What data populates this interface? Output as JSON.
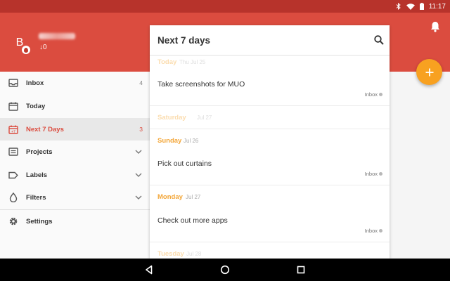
{
  "status_bar": {
    "time": "11:17"
  },
  "header": {
    "avatar_letter": "B",
    "karma": "↓0"
  },
  "sidebar": {
    "items": [
      {
        "label": "Inbox",
        "count": "4",
        "icon": "inbox-icon"
      },
      {
        "label": "Today",
        "count": "",
        "icon": "calendar-icon"
      },
      {
        "label": "Next 7 Days",
        "count": "3",
        "icon": "calendar-plus-icon",
        "active": true
      },
      {
        "label": "Projects",
        "icon": "list-icon"
      },
      {
        "label": "Labels",
        "icon": "tag-icon"
      },
      {
        "label": "Filters",
        "icon": "drop-icon"
      },
      {
        "label": "Settings",
        "icon": "gear-icon"
      }
    ]
  },
  "panel": {
    "title": "Next 7 days",
    "days": [
      {
        "name": "Today",
        "date": "Thu Jul 25"
      },
      {
        "name": "Saturday",
        "date": "Jul 27"
      },
      {
        "name": "Sunday",
        "date": "Jul 26"
      },
      {
        "name": "Monday",
        "date": "Jul 27"
      },
      {
        "name": "Tuesday",
        "date": "Jul 28"
      }
    ],
    "tasks": [
      {
        "title": "Take screenshots for MUO",
        "project": "Inbox"
      },
      {
        "title": "Pick out curtains",
        "project": "Inbox"
      },
      {
        "title": "Check out more apps",
        "project": "Inbox"
      }
    ]
  },
  "colors": {
    "accent": "#db4c3f",
    "status_bar": "#b7332b",
    "day_label": "#f3a638",
    "fab": "#f8a120"
  }
}
